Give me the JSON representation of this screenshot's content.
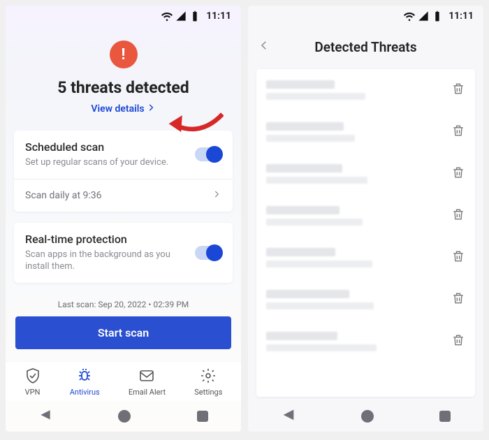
{
  "status": {
    "time": "11:11"
  },
  "left": {
    "alert": {
      "threat_title": "5 threats detected",
      "view_details": "View details"
    },
    "scheduled": {
      "title": "Scheduled scan",
      "sub": "Set up regular scans of your device.",
      "line": "Scan daily at 9:36"
    },
    "realtime": {
      "title": "Real-time protection",
      "sub": "Scan apps in the background as you install them."
    },
    "last_scan": "Last scan: Sep 20, 2022 • 02:39 PM",
    "start_scan": "Start scan",
    "tabs": {
      "vpn": "VPN",
      "antivirus": "Antivirus",
      "email": "Email Alert",
      "settings": "Settings"
    }
  },
  "right": {
    "title": "Detected Threats",
    "items": 7
  }
}
